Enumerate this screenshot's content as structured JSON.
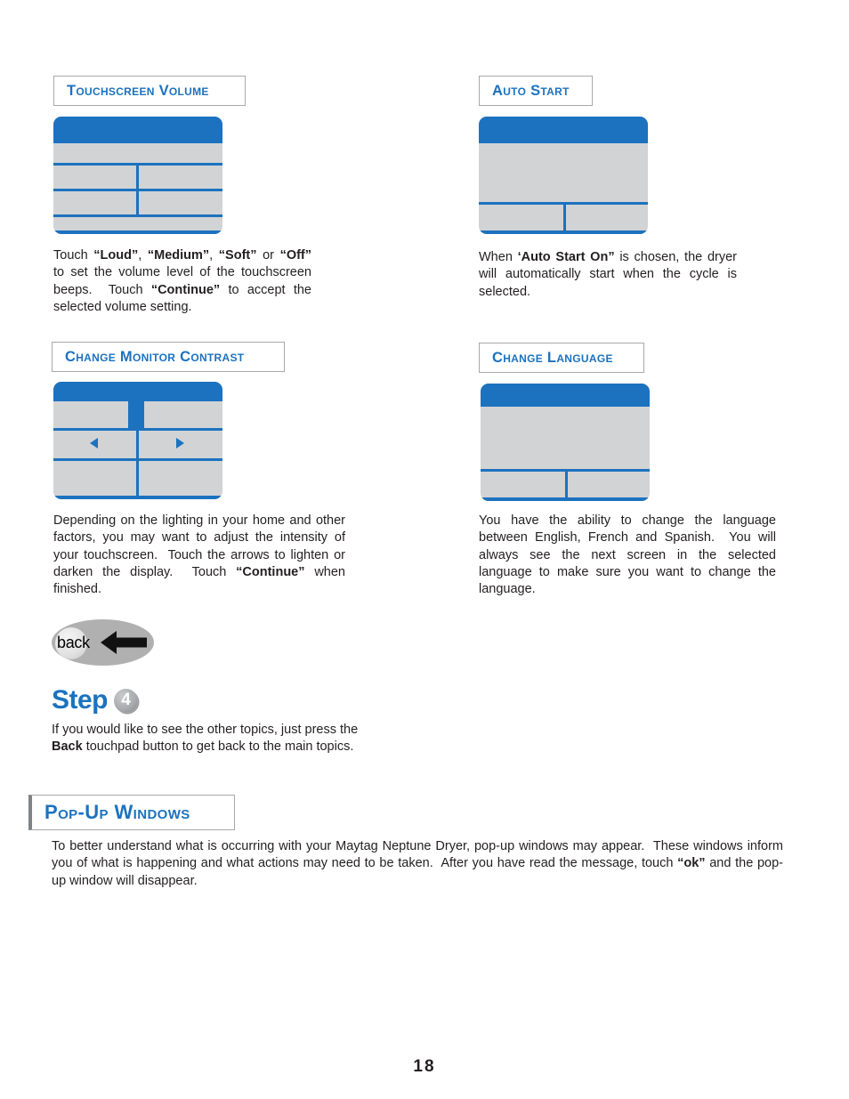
{
  "page": {
    "number": "18"
  },
  "sections": [
    {
      "id": "touchscreen-volume",
      "title": "Touchscreen Volume",
      "body_html": "Touch <b>&ldquo;Loud&rdquo;</b>, <b>&ldquo;Medium&rdquo;</b>, <b>&ldquo;Soft&rdquo;</b> or <b>&ldquo;Off&rdquo;</b> to set the volume level of the touchscreen beeps.&nbsp; Touch <b>&ldquo;Continue&rdquo;</b> to accept the selected volume setting.",
      "body_text": "Touch \"Loud\", \"Medium\", \"Soft\" or \"Off\" to set the volume level of the touchscreen beeps. Touch \"Continue\" to accept the selected volume setting.",
      "screen_layout": "grid-2x2-with-bottom-row"
    },
    {
      "id": "auto-start",
      "title": "Auto Start",
      "body_html": "When <b>&lsquo;Auto Start On&rdquo;</b> is chosen, the dryer will automatically start when the cycle is selected.",
      "body_text": "When 'Auto Start On\" is chosen, the dryer will automatically start when the cycle is selected.",
      "screen_layout": "single-bottom-split-row"
    },
    {
      "id": "change-monitor-contrast",
      "title": "Change Monitor Contrast",
      "body_html": "Depending on the lighting in your home and other factors, you may want to adjust the intensity of your touchscreen.&nbsp; Touch the arrows to lighten or darken the display.&nbsp; Touch <b>&ldquo;Continue&rdquo;</b> when finished.",
      "body_text": "Depending on the lighting in your home and other factors, you may want to adjust the intensity of your touchscreen. Touch the arrows to lighten or darken the display. Touch \"Continue\" when finished.",
      "screen_layout": "contrast-with-arrows",
      "arrows": [
        "left-arrow",
        "right-arrow"
      ]
    },
    {
      "id": "change-language",
      "title": "Change Language",
      "body_html": "You have the ability to change the language between English, French and Spanish.&nbsp; You will always see the next screen in the selected language to make sure you want to change the language.",
      "body_text": "You have the ability to change the language between English, French and Spanish. You will always see the next screen in the selected language to make sure you want to change the language.",
      "screen_layout": "single-bottom-split-row"
    }
  ],
  "back_button": {
    "label": "back",
    "icon": "left-arrow-icon"
  },
  "step": {
    "word": "Step",
    "number": "4",
    "body_html": "If you would like to see the other topics, just press the <b>Back</b> touchpad button to get back to the main topics.",
    "body_text": "If you would like to see the other topics, just press the Back touchpad button to get back to the main topics."
  },
  "popup_section": {
    "title": "Pop-Up Windows",
    "body_html": "To better understand what is occurring with your Maytag Neptune Dryer, pop-up windows may appear.&nbsp; These windows inform you of what is happening and what actions may need to be taken.&nbsp; After you have read the message, touch <b>&ldquo;ok&rdquo;</b> and the pop-up window will disappear.",
    "body_text": "To better understand what is occurring with your Maytag Neptune Dryer, pop-up windows may appear. These windows inform you of what is happening and what actions may need to be taken. After you have read the message, touch \"ok\" and the pop-up window will disappear."
  },
  "colors": {
    "accent_blue": "#1c72bf",
    "screen_gray": "#d2d3d5",
    "border_gray": "#a7a9ac",
    "text": "#231f20"
  }
}
